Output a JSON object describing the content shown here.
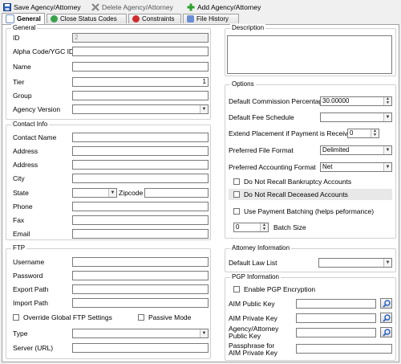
{
  "toolbar": {
    "save_label": "Save Agency/Attorney",
    "delete_label": "Delete Agency/Attorney",
    "add_label": "Add Agency/Attorney"
  },
  "tabs": [
    {
      "label": "General"
    },
    {
      "label": "Close Status Codes"
    },
    {
      "label": "Constraints"
    },
    {
      "label": "File History"
    }
  ],
  "general": {
    "legend": "General",
    "id_label": "ID",
    "id_value": "2",
    "alpha_label": "Alpha Code/YGC ID",
    "alpha_value": "",
    "name_label": "Name",
    "name_value": "",
    "tier_label": "Tier",
    "tier_value": "1",
    "group_label": "Group",
    "group_value": "",
    "version_label": "Agency Version",
    "version_value": ""
  },
  "contact": {
    "legend": "Contact Info",
    "contact_name_label": "Contact Name",
    "address1_label": "Address",
    "address2_label": "Address",
    "city_label": "City",
    "state_label": "State",
    "zip_label": "Zipcode",
    "phone_label": "Phone",
    "fax_label": "Fax",
    "email_label": "Email"
  },
  "ftp": {
    "legend": "FTP",
    "username_label": "Username",
    "password_label": "Password",
    "export_label": "Export Path",
    "import_label": "Import Path",
    "override_label": "Override Global FTP Settings",
    "passive_label": "Passive Mode",
    "type_label": "Type",
    "server_label": "Server (URL)"
  },
  "description": {
    "legend": "Description"
  },
  "options": {
    "legend": "Options",
    "commission_label": "Default Commission Percentage",
    "commission_value": "30.00000",
    "fee_label": "Default Fee Schedule",
    "fee_value": "",
    "extend_label": "Extend Placement if Payment is Received",
    "extend_value": "0",
    "file_format_label": "Preferred File Format",
    "file_format_value": "Delimited",
    "acct_format_label": "Preferred Accounting Format",
    "acct_format_value": "Net",
    "no_bankruptcy_label": "Do Not Recall Bankruptcy Accounts",
    "no_deceased_label": "Do Not Recall Deceased Accounts",
    "payment_batching_label": "Use Payment Batching (helps peformance)",
    "batch_size_value": "0",
    "batch_size_label": "Batch Size"
  },
  "attorney": {
    "legend": "Attorney Information",
    "law_list_label": "Default Law List",
    "law_list_value": ""
  },
  "pgp": {
    "legend": "PGP Information",
    "enable_label": "Enable PGP Encryption",
    "aim_public_label": "AIM Public Key",
    "aim_private_label": "AIM Private Key",
    "agency_public_label_1": "Agency/Attorney",
    "agency_public_label_2": "Public Key",
    "passphrase_label_1": "Passphrase for",
    "passphrase_label_2": "AIM Private Key"
  },
  "colors": {
    "accent": "#3c7fd6",
    "save_icon": "#2a63c2",
    "delete_icon": "#888888",
    "add_icon": "#2da12d"
  },
  "icons": {
    "save": "floppy-disk-icon",
    "delete": "delete-x-icon",
    "add": "green-plus-icon",
    "key": "magnifier-key-icon"
  }
}
